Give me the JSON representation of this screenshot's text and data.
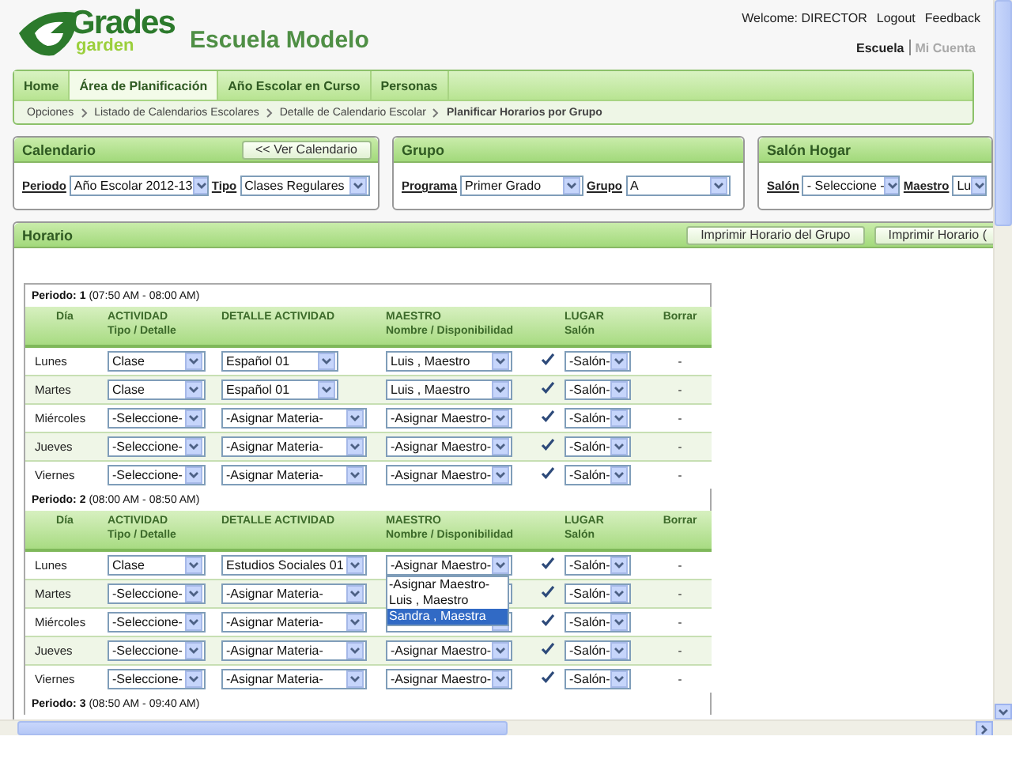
{
  "logo": {
    "word": "Grades",
    "sub": "garden"
  },
  "school_name": "Escuela Modelo",
  "user_bar": {
    "welcome": "Welcome: DIRECTOR",
    "links": [
      "Logout",
      "Feedback"
    ]
  },
  "account_links": [
    {
      "label": "Escuela",
      "selected": true
    },
    {
      "label": "Mi Cuenta",
      "selected": false
    }
  ],
  "tabs": [
    {
      "label": "Home",
      "selected": false
    },
    {
      "label": "Área de Planificación",
      "selected": true
    },
    {
      "label": "Año Escolar en Curso",
      "selected": false
    },
    {
      "label": "Personas",
      "selected": false
    }
  ],
  "breadcrumbs": [
    "Opciones",
    "Listado de Calendarios Escolares",
    "Detalle de Calendario Escolar",
    "Planificar Horarios por Grupo"
  ],
  "panels": [
    {
      "title": "Calendario",
      "button": "<< Ver Calendario",
      "fields": [
        {
          "label": "Periodo",
          "value": "Año Escolar 2012-13"
        },
        {
          "label": "Tipo",
          "value": "Clases Regulares"
        }
      ]
    },
    {
      "title": "Grupo",
      "fields": [
        {
          "label": "Programa",
          "value": "Primer Grado"
        },
        {
          "label": "Grupo",
          "value": "A"
        }
      ]
    },
    {
      "title": "Salón Hogar",
      "fields": [
        {
          "label": "Salón",
          "value": "- Seleccione -"
        },
        {
          "label": "Maestro",
          "value": "Lu"
        }
      ]
    }
  ],
  "horario": {
    "title": "Horario",
    "buttons": [
      "Imprimir Horario del Grupo",
      "Imprimir Horario ("
    ],
    "periods": [
      {
        "label": "Periodo: 1",
        "time": "(07:50 AM - 08:00 AM)",
        "columns": [
          {
            "title": "Día"
          },
          {
            "title": "ACTIVIDAD",
            "subtitle": "Tipo / Detalle"
          },
          {
            "title": "DETALLE ACTIVIDAD"
          },
          {
            "title": "MAESTRO",
            "subtitle": "Nombre / Disponibilidad"
          },
          {
            "title": "LUGAR",
            "subtitle": "Salón"
          },
          {
            "title": "Borrar"
          }
        ],
        "rows": [
          {
            "day": "Lunes",
            "tipo": "Clase",
            "detalle": "Español 01",
            "maestro": "Luis , Maestro",
            "available": true,
            "salon": "-Salón-",
            "borrar": "-"
          },
          {
            "day": "Martes",
            "tipo": "Clase",
            "detalle": "Español 01",
            "maestro": "Luis , Maestro",
            "available": true,
            "salon": "-Salón-",
            "borrar": "-"
          },
          {
            "day": "Miércoles",
            "tipo": "-Seleccione-",
            "detalle": "-Asignar Materia-",
            "maestro": "-Asignar Maestro-",
            "available": true,
            "salon": "-Salón-",
            "borrar": "-"
          },
          {
            "day": "Jueves",
            "tipo": "-Seleccione-",
            "detalle": "-Asignar Materia-",
            "maestro": "-Asignar Maestro-",
            "available": true,
            "salon": "-Salón-",
            "borrar": "-"
          },
          {
            "day": "Viernes",
            "tipo": "-Seleccione-",
            "detalle": "-Asignar Materia-",
            "maestro": "-Asignar Maestro-",
            "available": true,
            "salon": "-Salón-",
            "borrar": "-"
          }
        ]
      },
      {
        "label": "Periodo: 2",
        "time": "(08:00 AM - 08:50 AM)",
        "columns": [
          {
            "title": "Día"
          },
          {
            "title": "ACTIVIDAD",
            "subtitle": "Tipo / Detalle"
          },
          {
            "title": "DETALLE ACTIVIDAD"
          },
          {
            "title": "MAESTRO",
            "subtitle": "Nombre / Disponibilidad"
          },
          {
            "title": "LUGAR",
            "subtitle": "Salón"
          },
          {
            "title": "Borrar"
          }
        ],
        "rows": [
          {
            "day": "Lunes",
            "tipo": "Clase",
            "detalle": "Estudios Sociales 01",
            "maestro": "-Asignar Maestro-",
            "available": true,
            "salon": "-Salón-",
            "borrar": "-",
            "maestro_menu": [
              {
                "label": "-Asignar Maestro-",
                "selected": false
              },
              {
                "label": "Luis , Maestro",
                "selected": false
              },
              {
                "label": "Sandra , Maestra",
                "selected": true
              }
            ]
          },
          {
            "day": "Martes",
            "tipo": "-Seleccione-",
            "detalle": "-Asignar Materia-",
            "available": true,
            "salon": "-Salón-",
            "borrar": "-"
          },
          {
            "day": "Miércoles",
            "tipo": "-Seleccione-",
            "detalle": "-Asignar Materia-",
            "available": true,
            "salon": "-Salón-",
            "borrar": "-"
          },
          {
            "day": "Jueves",
            "tipo": "-Seleccione-",
            "detalle": "-Asignar Materia-",
            "maestro": "-Asignar Maestro-",
            "available": true,
            "salon": "-Salón-",
            "borrar": "-"
          },
          {
            "day": "Viernes",
            "tipo": "-Seleccione-",
            "detalle": "-Asignar Materia-",
            "maestro": "-Asignar Maestro-",
            "available": true,
            "salon": "-Salón-",
            "borrar": "-"
          }
        ]
      },
      {
        "label": "Periodo: 3",
        "time": "(08:50 AM - 09:40 AM)"
      }
    ]
  }
}
